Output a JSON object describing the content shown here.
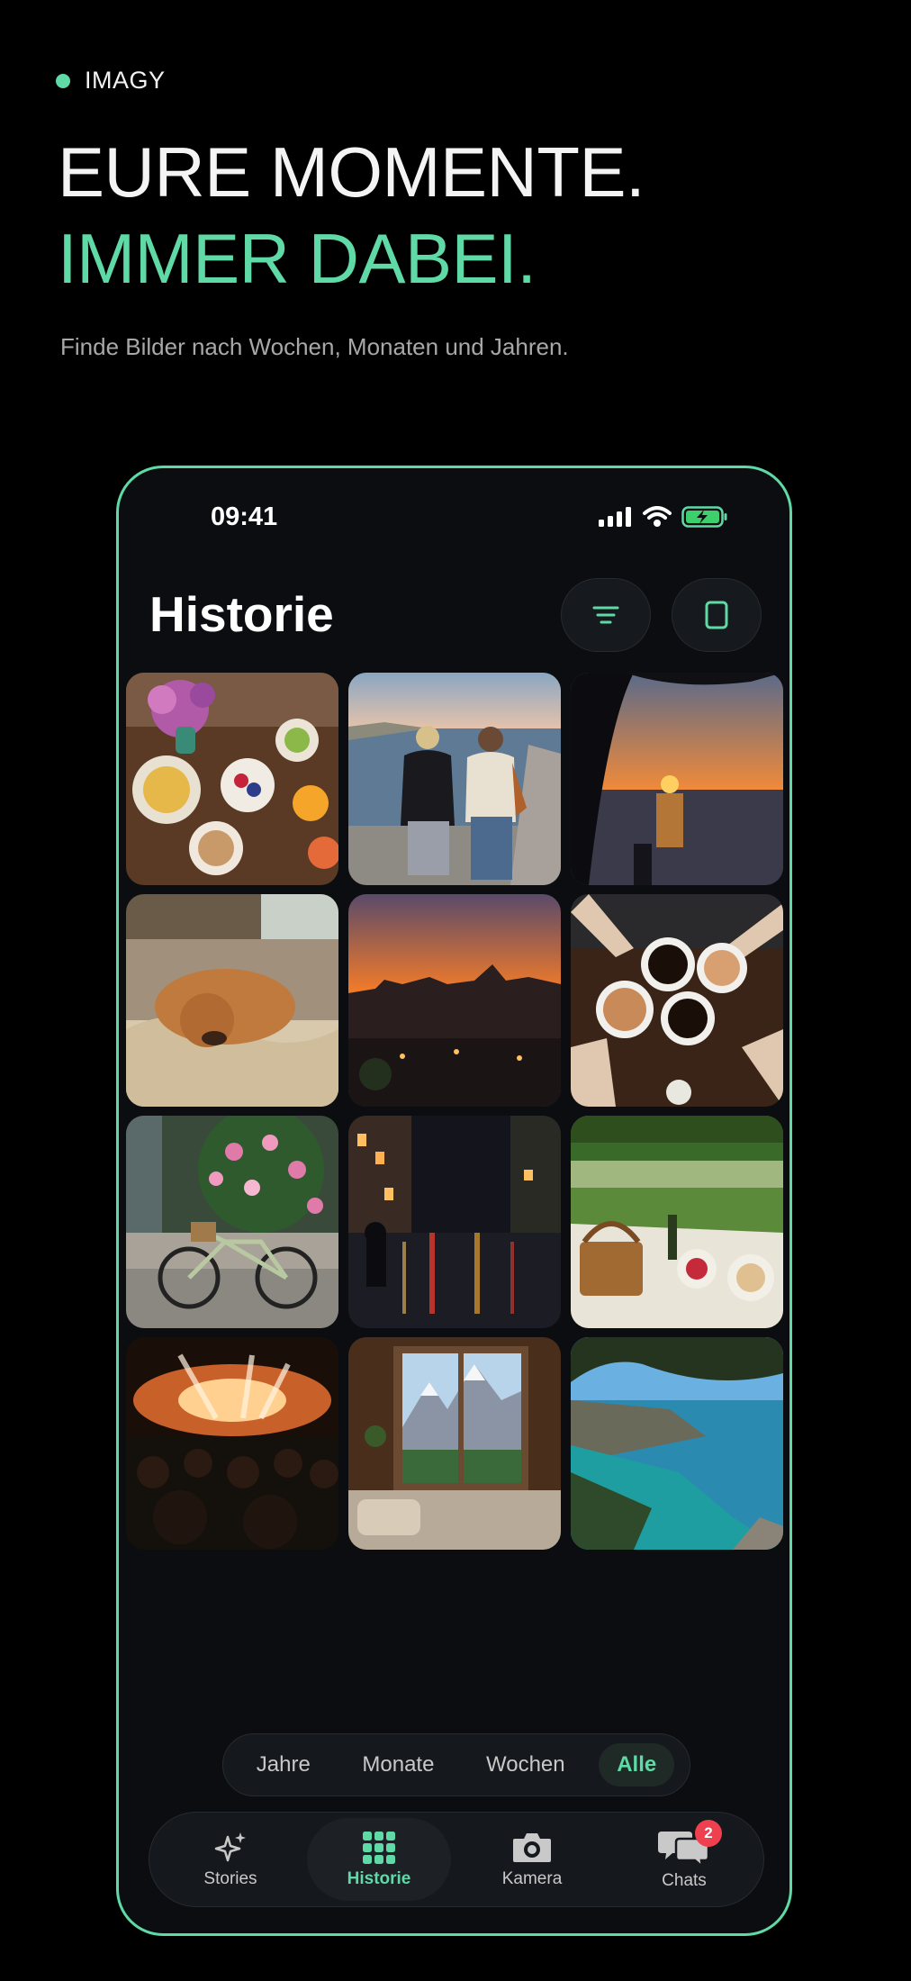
{
  "brand": {
    "name": "IMAGY",
    "accent": "#5fd9a6"
  },
  "hero": {
    "line1": "EURE MOMENTE.",
    "line2": "IMMER DABEI.",
    "subtitle": "Finde Bilder nach Wochen, Monaten und Jahren."
  },
  "status_bar": {
    "time": "09:41",
    "icons": [
      "signal-icon",
      "wifi-icon",
      "battery-charging-icon"
    ]
  },
  "screen": {
    "title": "Historie",
    "actions": [
      {
        "name": "filter-button",
        "icon": "filter-lines-icon"
      },
      {
        "name": "view-toggle-button",
        "icon": "square-icon"
      }
    ]
  },
  "photos": [
    {
      "subject": "brunch table"
    },
    {
      "subject": "two friends at seaside promenade"
    },
    {
      "subject": "sunset over lake"
    },
    {
      "subject": "dog sleeping on blanket"
    },
    {
      "subject": "city sunset rooftop"
    },
    {
      "subject": "coffee cups toast"
    },
    {
      "subject": "bicycle with roses"
    },
    {
      "subject": "rainy city night"
    },
    {
      "subject": "picnic in park"
    },
    {
      "subject": "concert crowd"
    },
    {
      "subject": "cabin window mountains"
    },
    {
      "subject": "turquoise bay"
    }
  ],
  "period_filter": {
    "options": [
      "Jahre",
      "Monate",
      "Wochen",
      "Alle"
    ],
    "selected": "Alle"
  },
  "tab_bar": {
    "tabs": [
      {
        "label": "Stories",
        "icon": "sparkles-icon"
      },
      {
        "label": "Historie",
        "icon": "grid-icon",
        "active": true
      },
      {
        "label": "Kamera",
        "icon": "camera-icon"
      },
      {
        "label": "Chats",
        "icon": "chat-bubbles-icon",
        "badge": "2"
      }
    ]
  }
}
